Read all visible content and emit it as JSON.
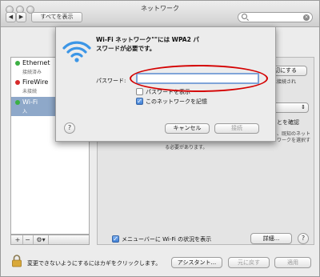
{
  "window": {
    "title": "ネットワーク",
    "show_all_label": "すべてを表示",
    "back_glyph": "◀",
    "forward_glyph": "▶",
    "search_clear_glyph": "×"
  },
  "sidebar": {
    "items": [
      {
        "name": "Ethernet",
        "status": "接続済み",
        "dot_color": "#3cb043"
      },
      {
        "name": "FireWire",
        "status": "未接続",
        "dot_color": "#d62a2a"
      },
      {
        "name": "Wi-Fi",
        "status": "入",
        "dot_color": "#3cb043"
      }
    ],
    "add_glyph": "+",
    "remove_glyph": "−",
    "gear_glyph": "⚙▾"
  },
  "panel": {
    "wifi_off_button": "切にする",
    "status_text_fragment": "には接続され",
    "popup_arrow": "⇕",
    "confirm_text": "とを確認",
    "info_line1": "、既知のネット",
    "info_line2": "ワークを選択す",
    "info_line3": "る必要があります。",
    "show_wifi_status_label": "メニューバーに Wi-Fi の状況を表示",
    "advanced_button": "詳細...",
    "help_glyph": "?"
  },
  "dialog": {
    "title_line1": "Wi-Fi ネットワーク\"\"には WPA2 パ",
    "title_line2": "スワードが必要です。",
    "password_label": "パスワード:",
    "password_value": "",
    "show_password_label": "パスワードを表示",
    "remember_label": "このネットワークを記憶",
    "remember_checked": true,
    "show_password_checked": false,
    "cancel_button": "キャンセル",
    "join_button": "接続",
    "help_glyph": "?",
    "check_glyph": "✓"
  },
  "bottom": {
    "lock_text": "変更できないようにするにはカギをクリックします。",
    "assistant_button": "アシスタント...",
    "revert_button": "元に戻す",
    "apply_button": "適用"
  }
}
